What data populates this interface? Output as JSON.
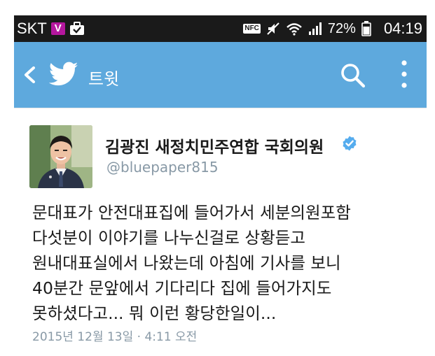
{
  "status_bar": {
    "carrier": "SKT",
    "v_badge": "V",
    "nfc_label": "NFC",
    "battery": "72%",
    "time": "04:19"
  },
  "app_bar": {
    "title": "트윗",
    "background": "#5ea9dd",
    "icons": [
      "chevron-left-icon",
      "twitter-bird-icon",
      "search-icon",
      "more-vertical-icon"
    ]
  },
  "tweet": {
    "author_name": "김광진 새정치민주연합 국회의원",
    "verified": true,
    "handle": "@bluepaper815",
    "text_lines": [
      "문대표가 안전대표집에 들어가서 세분의원포함",
      "다섯분이 이야기를 나누신걸로 상황듣고",
      "원내대표실에서 나왔는데 아침에 기사를 보니",
      "40분간 문앞에서 기다리다 집에 들어가지도",
      "못하셨다고... 뭐 이런 황당한일이..."
    ],
    "timestamp": "2015년 12월 13일 · 4:11 오전"
  },
  "colors": {
    "status_bar_bg": "#1a1a1a",
    "twitter_blue": "#5ea9dd",
    "verified_blue": "#55acee",
    "muted_text": "#8899a6",
    "v_badge": "#b5179e"
  }
}
